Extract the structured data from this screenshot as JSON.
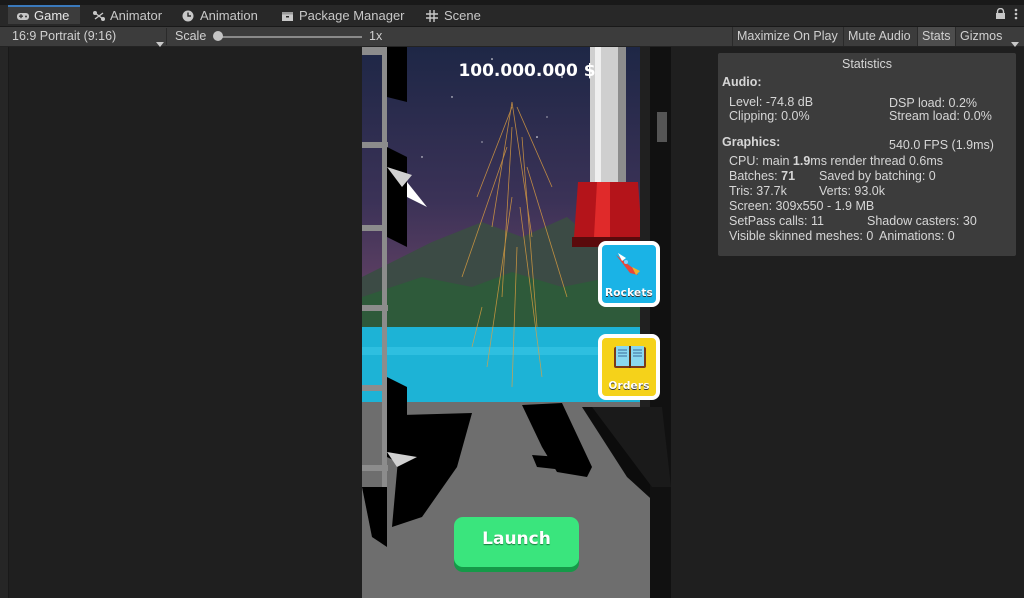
{
  "tabs": [
    {
      "label": "Game",
      "icon": "gamepad-icon",
      "active": true
    },
    {
      "label": "Animator",
      "icon": "animator-icon",
      "active": false
    },
    {
      "label": "Animation",
      "icon": "clock-icon",
      "active": false
    },
    {
      "label": "Package Manager",
      "icon": "package-icon",
      "active": false
    },
    {
      "label": "Scene",
      "icon": "grid-icon",
      "active": false
    }
  ],
  "toolbar": {
    "aspect": "16:9 Portrait (9:16)",
    "scale_label": "Scale",
    "scale_value": "1x",
    "scale_level": 0.0,
    "maximize": "Maximize On Play",
    "mute": "Mute Audio",
    "stats": "Stats",
    "gizmos": "Gizmos"
  },
  "game": {
    "money": "100.000.000 $",
    "rockets_label": "Rockets",
    "orders_label": "Orders",
    "launch_label": "Launch"
  },
  "stats": {
    "title": "Statistics",
    "audio_header": "Audio:",
    "level": "Level: -74.8 dB",
    "dsp": "DSP load: 0.2%",
    "clipping": "Clipping: 0.0%",
    "stream": "Stream load: 0.0%",
    "graphics_header": "Graphics:",
    "fps": "540.0 FPS (1.9ms)",
    "cpu_prefix": "CPU: main ",
    "cpu_main": "1.9",
    "cpu_suffix": "ms  render thread 0.6ms",
    "batches_prefix": "Batches: ",
    "batches": "71",
    "saved": "Saved by batching: 0",
    "tris": "Tris: 37.7k",
    "verts": "Verts: 93.0k",
    "screen": "Screen: 309x550 - 1.9 MB",
    "setpass": "SetPass calls: 11",
    "shadow": "Shadow casters: 30",
    "skinned": "Visible skinned meshes: 0",
    "animations": "Animations: 0"
  },
  "colors": {
    "accent": "#3a79bb",
    "launch": "#3ae57d",
    "rockets_bg": "#1ab3e6",
    "orders_bg": "#f5d21a"
  }
}
